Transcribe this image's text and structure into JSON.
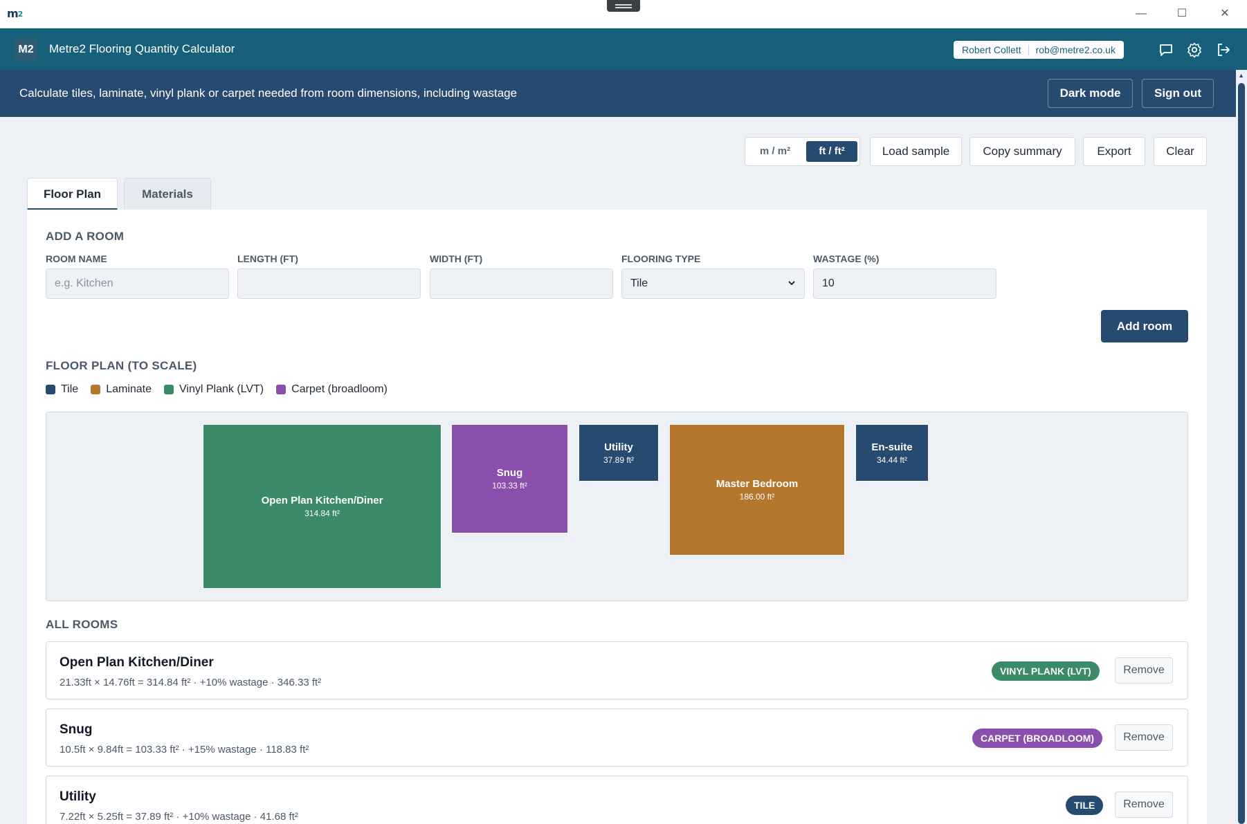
{
  "window": {
    "logo_main": "m",
    "logo_sub": "2",
    "minimize": "—",
    "maximize": "☐",
    "close": "✕"
  },
  "header": {
    "badge": "M2",
    "title": "Metre2 Flooring Quantity Calculator",
    "user_name": "Robert Collett",
    "user_email": "rob@metre2.co.uk",
    "icons": [
      "chat-icon",
      "gear-icon",
      "logout-icon"
    ]
  },
  "subbar": {
    "description": "Calculate tiles, laminate, vinyl plank or carpet needed from room dimensions, including wastage",
    "dark_mode": "Dark mode",
    "sign_out": "Sign out"
  },
  "toolbar": {
    "unit_metric": "m / m²",
    "unit_imperial": "ft / ft²",
    "unit_selected": "ft / ft²",
    "load_sample": "Load sample",
    "copy_summary": "Copy summary",
    "export": "Export",
    "clear": "Clear"
  },
  "tabs": [
    {
      "label": "Floor Plan",
      "active": true
    },
    {
      "label": "Materials",
      "active": false
    }
  ],
  "add_room": {
    "title": "ADD A ROOM",
    "room_name_label": "ROOM NAME",
    "room_name_placeholder": "e.g. Kitchen",
    "room_name_value": "",
    "length_label": "LENGTH (FT)",
    "length_value": "",
    "width_label": "WIDTH (FT)",
    "width_value": "",
    "flooring_label": "FLOORING TYPE",
    "flooring_value": "Tile",
    "wastage_label": "WASTAGE (%)",
    "wastage_value": "10",
    "add_button": "Add room"
  },
  "floor_plan": {
    "title": "FLOOR PLAN (TO SCALE)",
    "legend": [
      {
        "label": "Tile",
        "color": "#264a70"
      },
      {
        "label": "Laminate",
        "color": "#b5762e"
      },
      {
        "label": "Vinyl Plank (LVT)",
        "color": "#3b8a68"
      },
      {
        "label": "Carpet (broadloom)",
        "color": "#8a4fad"
      }
    ],
    "rooms": [
      {
        "name": "Open Plan Kitchen/Diner",
        "area": "314.84 ft²",
        "color": "#3b8a68"
      },
      {
        "name": "Snug",
        "area": "103.33 ft²",
        "color": "#8a4fad"
      },
      {
        "name": "Utility",
        "area": "37.89 ft²",
        "color": "#264a70"
      },
      {
        "name": "Master Bedroom",
        "area": "186.00 ft²",
        "color": "#b5762e"
      },
      {
        "name": "En-suite",
        "area": "34.44 ft²",
        "color": "#264a70"
      }
    ]
  },
  "all_rooms": {
    "title": "ALL ROOMS",
    "remove_label": "Remove",
    "items": [
      {
        "name": "Open Plan Kitchen/Diner",
        "detail": "21.33ft × 14.76ft = 314.84 ft² · +10% wastage · 346.33 ft²",
        "badge": "VINYL PLANK (LVT)",
        "badge_color": "#3b8a68"
      },
      {
        "name": "Snug",
        "detail": "10.5ft × 9.84ft = 103.33 ft² · +15% wastage · 118.83 ft²",
        "badge": "CARPET (BROADLOOM)",
        "badge_color": "#8a4fad"
      },
      {
        "name": "Utility",
        "detail": "7.22ft × 5.25ft = 37.89 ft² · +10% wastage · 41.68 ft²",
        "badge": "TILE",
        "badge_color": "#264a70"
      }
    ]
  }
}
